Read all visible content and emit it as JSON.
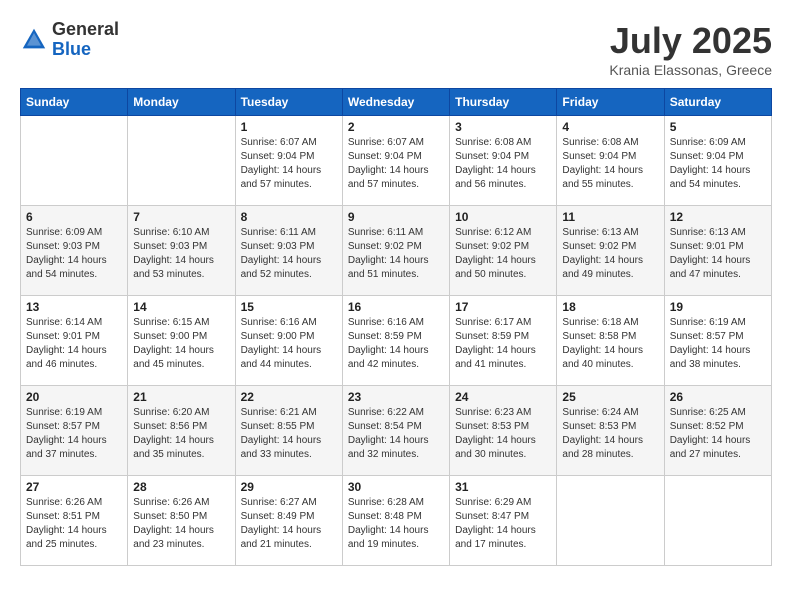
{
  "header": {
    "logo_general": "General",
    "logo_blue": "Blue",
    "title": "July 2025",
    "subtitle": "Krania Elassonas, Greece"
  },
  "weekdays": [
    "Sunday",
    "Monday",
    "Tuesday",
    "Wednesday",
    "Thursday",
    "Friday",
    "Saturday"
  ],
  "weeks": [
    [
      {
        "day": "",
        "sunrise": "",
        "sunset": "",
        "daylight": ""
      },
      {
        "day": "",
        "sunrise": "",
        "sunset": "",
        "daylight": ""
      },
      {
        "day": "1",
        "sunrise": "Sunrise: 6:07 AM",
        "sunset": "Sunset: 9:04 PM",
        "daylight": "Daylight: 14 hours and 57 minutes."
      },
      {
        "day": "2",
        "sunrise": "Sunrise: 6:07 AM",
        "sunset": "Sunset: 9:04 PM",
        "daylight": "Daylight: 14 hours and 57 minutes."
      },
      {
        "day": "3",
        "sunrise": "Sunrise: 6:08 AM",
        "sunset": "Sunset: 9:04 PM",
        "daylight": "Daylight: 14 hours and 56 minutes."
      },
      {
        "day": "4",
        "sunrise": "Sunrise: 6:08 AM",
        "sunset": "Sunset: 9:04 PM",
        "daylight": "Daylight: 14 hours and 55 minutes."
      },
      {
        "day": "5",
        "sunrise": "Sunrise: 6:09 AM",
        "sunset": "Sunset: 9:04 PM",
        "daylight": "Daylight: 14 hours and 54 minutes."
      }
    ],
    [
      {
        "day": "6",
        "sunrise": "Sunrise: 6:09 AM",
        "sunset": "Sunset: 9:03 PM",
        "daylight": "Daylight: 14 hours and 54 minutes."
      },
      {
        "day": "7",
        "sunrise": "Sunrise: 6:10 AM",
        "sunset": "Sunset: 9:03 PM",
        "daylight": "Daylight: 14 hours and 53 minutes."
      },
      {
        "day": "8",
        "sunrise": "Sunrise: 6:11 AM",
        "sunset": "Sunset: 9:03 PM",
        "daylight": "Daylight: 14 hours and 52 minutes."
      },
      {
        "day": "9",
        "sunrise": "Sunrise: 6:11 AM",
        "sunset": "Sunset: 9:02 PM",
        "daylight": "Daylight: 14 hours and 51 minutes."
      },
      {
        "day": "10",
        "sunrise": "Sunrise: 6:12 AM",
        "sunset": "Sunset: 9:02 PM",
        "daylight": "Daylight: 14 hours and 50 minutes."
      },
      {
        "day": "11",
        "sunrise": "Sunrise: 6:13 AM",
        "sunset": "Sunset: 9:02 PM",
        "daylight": "Daylight: 14 hours and 49 minutes."
      },
      {
        "day": "12",
        "sunrise": "Sunrise: 6:13 AM",
        "sunset": "Sunset: 9:01 PM",
        "daylight": "Daylight: 14 hours and 47 minutes."
      }
    ],
    [
      {
        "day": "13",
        "sunrise": "Sunrise: 6:14 AM",
        "sunset": "Sunset: 9:01 PM",
        "daylight": "Daylight: 14 hours and 46 minutes."
      },
      {
        "day": "14",
        "sunrise": "Sunrise: 6:15 AM",
        "sunset": "Sunset: 9:00 PM",
        "daylight": "Daylight: 14 hours and 45 minutes."
      },
      {
        "day": "15",
        "sunrise": "Sunrise: 6:16 AM",
        "sunset": "Sunset: 9:00 PM",
        "daylight": "Daylight: 14 hours and 44 minutes."
      },
      {
        "day": "16",
        "sunrise": "Sunrise: 6:16 AM",
        "sunset": "Sunset: 8:59 PM",
        "daylight": "Daylight: 14 hours and 42 minutes."
      },
      {
        "day": "17",
        "sunrise": "Sunrise: 6:17 AM",
        "sunset": "Sunset: 8:59 PM",
        "daylight": "Daylight: 14 hours and 41 minutes."
      },
      {
        "day": "18",
        "sunrise": "Sunrise: 6:18 AM",
        "sunset": "Sunset: 8:58 PM",
        "daylight": "Daylight: 14 hours and 40 minutes."
      },
      {
        "day": "19",
        "sunrise": "Sunrise: 6:19 AM",
        "sunset": "Sunset: 8:57 PM",
        "daylight": "Daylight: 14 hours and 38 minutes."
      }
    ],
    [
      {
        "day": "20",
        "sunrise": "Sunrise: 6:19 AM",
        "sunset": "Sunset: 8:57 PM",
        "daylight": "Daylight: 14 hours and 37 minutes."
      },
      {
        "day": "21",
        "sunrise": "Sunrise: 6:20 AM",
        "sunset": "Sunset: 8:56 PM",
        "daylight": "Daylight: 14 hours and 35 minutes."
      },
      {
        "day": "22",
        "sunrise": "Sunrise: 6:21 AM",
        "sunset": "Sunset: 8:55 PM",
        "daylight": "Daylight: 14 hours and 33 minutes."
      },
      {
        "day": "23",
        "sunrise": "Sunrise: 6:22 AM",
        "sunset": "Sunset: 8:54 PM",
        "daylight": "Daylight: 14 hours and 32 minutes."
      },
      {
        "day": "24",
        "sunrise": "Sunrise: 6:23 AM",
        "sunset": "Sunset: 8:53 PM",
        "daylight": "Daylight: 14 hours and 30 minutes."
      },
      {
        "day": "25",
        "sunrise": "Sunrise: 6:24 AM",
        "sunset": "Sunset: 8:53 PM",
        "daylight": "Daylight: 14 hours and 28 minutes."
      },
      {
        "day": "26",
        "sunrise": "Sunrise: 6:25 AM",
        "sunset": "Sunset: 8:52 PM",
        "daylight": "Daylight: 14 hours and 27 minutes."
      }
    ],
    [
      {
        "day": "27",
        "sunrise": "Sunrise: 6:26 AM",
        "sunset": "Sunset: 8:51 PM",
        "daylight": "Daylight: 14 hours and 25 minutes."
      },
      {
        "day": "28",
        "sunrise": "Sunrise: 6:26 AM",
        "sunset": "Sunset: 8:50 PM",
        "daylight": "Daylight: 14 hours and 23 minutes."
      },
      {
        "day": "29",
        "sunrise": "Sunrise: 6:27 AM",
        "sunset": "Sunset: 8:49 PM",
        "daylight": "Daylight: 14 hours and 21 minutes."
      },
      {
        "day": "30",
        "sunrise": "Sunrise: 6:28 AM",
        "sunset": "Sunset: 8:48 PM",
        "daylight": "Daylight: 14 hours and 19 minutes."
      },
      {
        "day": "31",
        "sunrise": "Sunrise: 6:29 AM",
        "sunset": "Sunset: 8:47 PM",
        "daylight": "Daylight: 14 hours and 17 minutes."
      },
      {
        "day": "",
        "sunrise": "",
        "sunset": "",
        "daylight": ""
      },
      {
        "day": "",
        "sunrise": "",
        "sunset": "",
        "daylight": ""
      }
    ]
  ]
}
